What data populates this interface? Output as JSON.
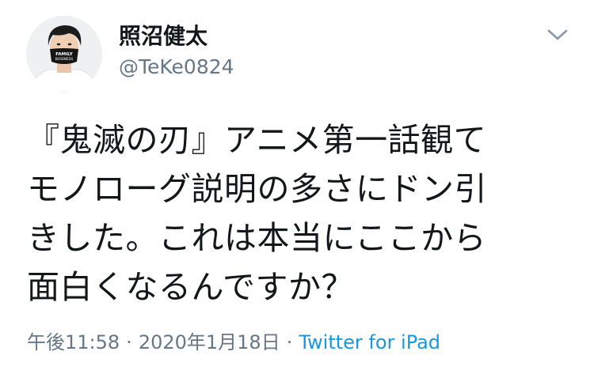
{
  "user": {
    "display_name": "照沼健太",
    "handle": "@TeKe0824",
    "avatar_mask_text": [
      "FAMILY",
      "BUSINESS"
    ]
  },
  "menu": {
    "icon": "chevron-down-icon"
  },
  "tweet": {
    "text": "『鬼滅の刃』アニメ第一話観て\nモノローグ説明の多さにドン引\nきした。これは本当にここから\n面白くなるんですか？"
  },
  "meta": {
    "time": "午後11:58",
    "separator": "·",
    "date": "2020年1月18日",
    "source": "Twitter for iPad"
  },
  "colors": {
    "text": "#14171a",
    "secondary": "#657786",
    "link": "#1b95e0"
  }
}
